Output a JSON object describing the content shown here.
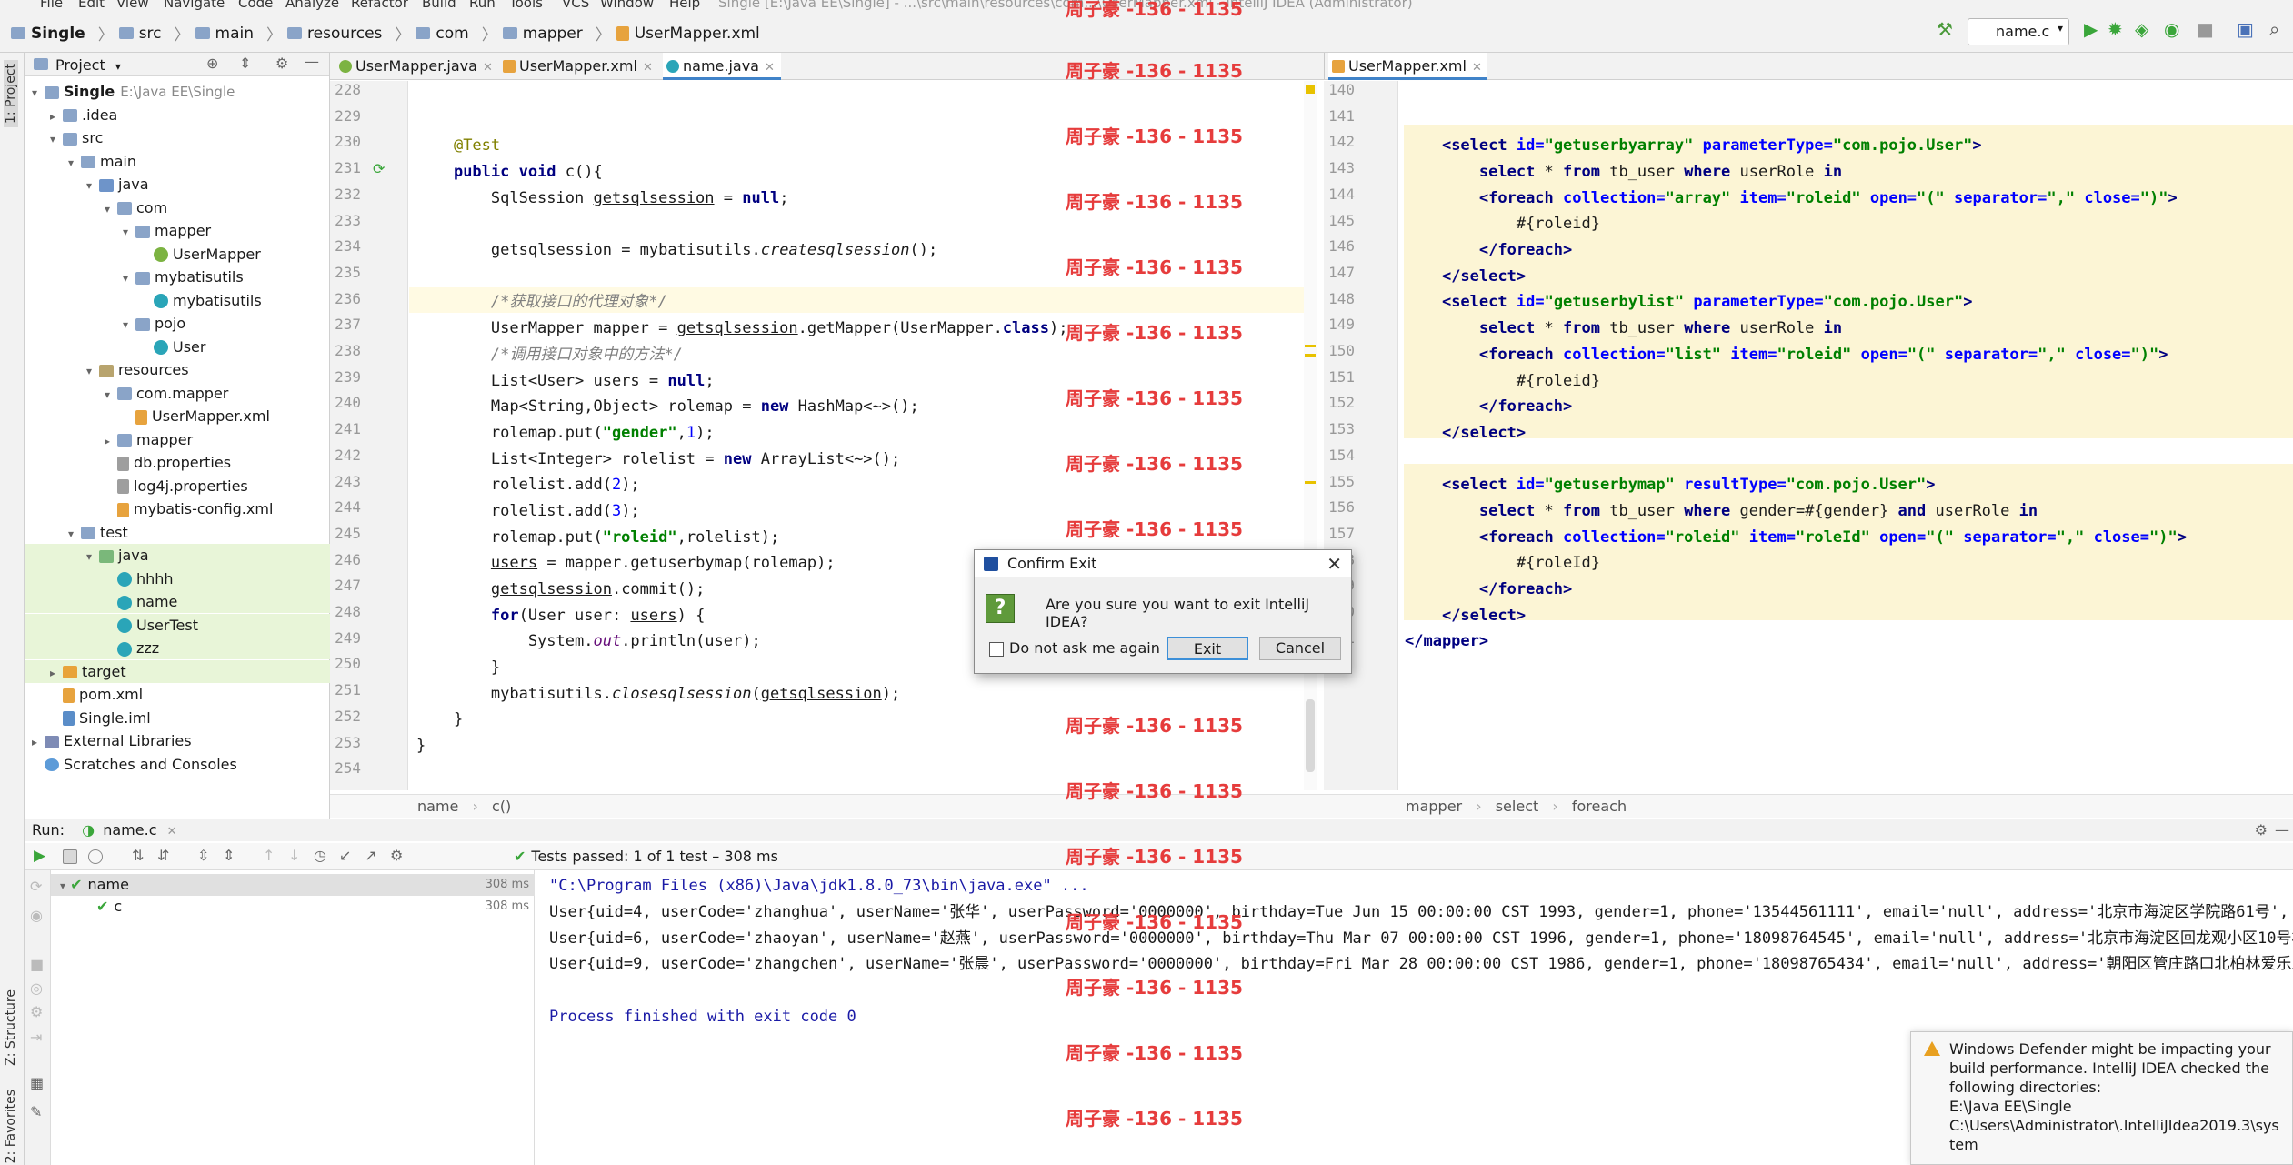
{
  "window": {
    "title": "Single [E:\\Java EE\\Single] - ...\\src\\main\\resources\\com...\\UserMapper.xml - IntelliJ IDEA (Administrator)",
    "menu": [
      "File",
      "Edit",
      "View",
      "Navigate",
      "Code",
      "Analyze",
      "Refactor",
      "Build",
      "Run",
      "Tools",
      "VCS",
      "Window",
      "Help"
    ]
  },
  "breadcrumb": [
    "Single",
    "src",
    "main",
    "resources",
    "com",
    "mapper",
    "UserMapper.xml"
  ],
  "run_config": "name.c",
  "left_strip": {
    "project_tab": "1: Project",
    "structure_tab": "Z: Structure",
    "favorites_tab": "2: Favorites"
  },
  "project": {
    "header": "Project",
    "tree": [
      {
        "label": "Single",
        "hint": "E:\\Java EE\\Single",
        "depth": 0,
        "icon": "folder-icon",
        "arrow": "▾",
        "bold": true
      },
      {
        "label": ".idea",
        "depth": 1,
        "icon": "folder-icon",
        "arrow": "▸"
      },
      {
        "label": "src",
        "depth": 1,
        "icon": "folder-icon",
        "arrow": "▾"
      },
      {
        "label": "main",
        "depth": 2,
        "icon": "folder-icon",
        "arrow": "▾"
      },
      {
        "label": "java",
        "depth": 3,
        "icon": "folder-src-icon",
        "arrow": "▾"
      },
      {
        "label": "com",
        "depth": 4,
        "icon": "folder-icon",
        "arrow": "▾"
      },
      {
        "label": "mapper",
        "depth": 5,
        "icon": "folder-icon",
        "arrow": "▾"
      },
      {
        "label": "UserMapper",
        "depth": 6,
        "icon": "interface-icon",
        "arrow": ""
      },
      {
        "label": "mybatisutils",
        "depth": 5,
        "icon": "folder-icon",
        "arrow": "▾"
      },
      {
        "label": "mybatisutils",
        "depth": 6,
        "icon": "class-icon",
        "arrow": ""
      },
      {
        "label": "pojo",
        "depth": 5,
        "icon": "folder-icon",
        "arrow": "▾"
      },
      {
        "label": "User",
        "depth": 6,
        "icon": "class-icon",
        "arrow": ""
      },
      {
        "label": "resources",
        "depth": 3,
        "icon": "folder-res-icon",
        "arrow": "▾"
      },
      {
        "label": "com.mapper",
        "depth": 4,
        "icon": "folder-icon",
        "arrow": "▾"
      },
      {
        "label": "UserMapper.xml",
        "depth": 5,
        "icon": "xml-icon",
        "arrow": ""
      },
      {
        "label": "mapper",
        "depth": 4,
        "icon": "folder-icon",
        "arrow": "▸"
      },
      {
        "label": "db.properties",
        "depth": 4,
        "icon": "properties-icon",
        "arrow": ""
      },
      {
        "label": "log4j.properties",
        "depth": 4,
        "icon": "properties-icon",
        "arrow": ""
      },
      {
        "label": "mybatis-config.xml",
        "depth": 4,
        "icon": "xml-icon",
        "arrow": ""
      },
      {
        "label": "test",
        "depth": 2,
        "icon": "folder-icon",
        "arrow": "▾"
      },
      {
        "label": "java",
        "depth": 3,
        "icon": "folder-test-icon",
        "arrow": "▾",
        "selected": true
      },
      {
        "label": "hhhh",
        "depth": 4,
        "icon": "class-icon",
        "arrow": "",
        "selected": true
      },
      {
        "label": "name",
        "depth": 4,
        "icon": "class-icon",
        "arrow": "",
        "selected": true
      },
      {
        "label": "UserTest",
        "depth": 4,
        "icon": "class-icon",
        "arrow": "",
        "selected": true
      },
      {
        "label": "zzz",
        "depth": 4,
        "icon": "class-icon",
        "arrow": "",
        "selected": true
      },
      {
        "label": "target",
        "depth": 1,
        "icon": "folder-target-icon",
        "arrow": "▸",
        "selected": true
      },
      {
        "label": "pom.xml",
        "depth": 1,
        "icon": "xml-icon",
        "arrow": ""
      },
      {
        "label": "Single.iml",
        "depth": 1,
        "icon": "iml-icon",
        "arrow": ""
      },
      {
        "label": "External Libraries",
        "depth": 0,
        "icon": "library-icon",
        "arrow": "▸"
      },
      {
        "label": "Scratches and Consoles",
        "depth": 0,
        "icon": "scratch-icon",
        "arrow": ""
      }
    ]
  },
  "left_editor": {
    "tabs": [
      {
        "label": "UserMapper.java",
        "icon": "interface-icon",
        "active": false
      },
      {
        "label": "UserMapper.xml",
        "icon": "xml-icon",
        "active": false
      },
      {
        "label": "name.java",
        "icon": "class-icon",
        "active": true
      }
    ],
    "line_numbers": [
      "228",
      "229",
      "230",
      "231",
      "232",
      "233",
      "234",
      "235",
      "236",
      "237",
      "238",
      "239",
      "240",
      "241",
      "242",
      "243",
      "244",
      "245",
      "246",
      "247",
      "248",
      "249",
      "250",
      "251",
      "252",
      "253",
      "254"
    ],
    "breadcrumb": [
      "name",
      "c()"
    ]
  },
  "right_editor": {
    "tabs": [
      {
        "label": "UserMapper.xml",
        "icon": "xml-icon",
        "active": true
      }
    ],
    "line_numbers": [
      "140",
      "141",
      "142",
      "143",
      "144",
      "145",
      "146",
      "147",
      "148",
      "149",
      "150",
      "151",
      "152",
      "153",
      "154",
      "155",
      "156",
      "157",
      "158",
      "159",
      "160",
      "161"
    ],
    "breadcrumb": [
      "mapper",
      "select",
      "foreach"
    ]
  },
  "run": {
    "header_label": "Run:",
    "tab_label": "name.c",
    "status": "Tests passed:",
    "status_detail": "1 of 1 test – 308 ms",
    "tests": [
      {
        "name": "name",
        "time": "308 ms"
      },
      {
        "name": "c",
        "time": "308 ms"
      }
    ],
    "console": [
      "\"C:\\Program Files (x86)\\Java\\jdk1.8.0_73\\bin\\java.exe\" ...",
      "User{uid=4, userCode='zhanghua', userName='张华', userPassword='0000000', birthday=Tue Jun 15 00:00:00 CST 1993, gender=1, phone='13544561111', email='null', address='北京市海淀区学院路61号', use",
      "User{uid=6, userCode='zhaoyan', userName='赵燕', userPassword='0000000', birthday=Thu Mar 07 00:00:00 CST 1996, gender=1, phone='18098764545', email='null', address='北京市海淀区回龙观小区10号楼'",
      "User{uid=9, userCode='zhangchen', userName='张晨', userPassword='0000000', birthday=Fri Mar 28 00:00:00 CST 1986, gender=1, phone='18098765434', email='null', address='朝阳区管庄路口北柏林爱乐三期",
      "",
      "Process finished with exit code 0"
    ]
  },
  "watermark": "周子豪 -136 - 1135",
  "dialog": {
    "title": "Confirm Exit",
    "message": "Are you sure you want to exit IntelliJ IDEA?",
    "checkbox_label": "Do not ask me again",
    "exit_label": "Exit",
    "cancel_label": "Cancel"
  },
  "notification": {
    "lines": [
      "Windows Defender might be impacting your",
      "build performance. IntelliJ IDEA checked the",
      "following directories:",
      "E:\\Java EE\\Single",
      "C:\\Users\\Administrator\\.IntelliJIdea2019.3\\sys",
      "tem"
    ]
  }
}
